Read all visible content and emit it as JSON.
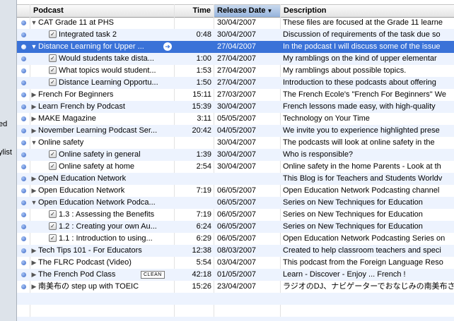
{
  "sidebar": {
    "fragments": [
      "ed",
      "ylist"
    ]
  },
  "columns": {
    "podcast": "Podcast",
    "time": "Time",
    "release_date": "Release Date",
    "description": "Description",
    "sort_indicator": "▼"
  },
  "clean_badge": "CLEAN",
  "rows": [
    {
      "kind": "parent",
      "open": true,
      "name": "CAT Grade 11 at PHS",
      "time": "",
      "date": "30/04/2007",
      "desc": "These files are focused at the Grade 11 learne"
    },
    {
      "kind": "child",
      "name": "Integrated task 2",
      "time": "0:48",
      "date": "30/04/2007",
      "desc": "Discussion of requirements of the task due so"
    },
    {
      "kind": "parent",
      "open": true,
      "selected": true,
      "name": "Distance Learning for Upper ...",
      "time": "",
      "date": "27/04/2007",
      "desc": "In the podcast I will discuss some of the issue"
    },
    {
      "kind": "child",
      "name": "Would students take dista...",
      "time": "1:00",
      "date": "27/04/2007",
      "desc": "My ramblings on the kind of upper elementar"
    },
    {
      "kind": "child",
      "name": "What topics would student...",
      "time": "1:53",
      "date": "27/04/2007",
      "desc": "My ramblings about possible topics."
    },
    {
      "kind": "child",
      "name": "Distance Learning Opportu...",
      "time": "1:50",
      "date": "27/04/2007",
      "desc": "Introduction to these podcasts about offering"
    },
    {
      "kind": "parent",
      "open": false,
      "name": "French For Beginners",
      "time": "15:11",
      "date": "27/03/2007",
      "desc": "The French Ecole's \"French For Beginners\" We"
    },
    {
      "kind": "parent",
      "open": false,
      "name": "Learn French by Podcast",
      "time": "15:39",
      "date": "30/04/2007",
      "desc": "French lessons made easy, with high-quality"
    },
    {
      "kind": "parent",
      "open": false,
      "name": "MAKE Magazine",
      "time": "3:11",
      "date": "05/05/2007",
      "desc": "Technology on Your Time"
    },
    {
      "kind": "parent",
      "open": false,
      "name": "November Learning Podcast Ser...",
      "time": "20:42",
      "date": "04/05/2007",
      "desc": "We invite you to experience highlighted prese"
    },
    {
      "kind": "parent",
      "open": true,
      "name": "Online safety",
      "time": "",
      "date": "30/04/2007",
      "desc": "The podcasts will look at online safety in the"
    },
    {
      "kind": "child",
      "name": "Online safety in general",
      "time": "1:39",
      "date": "30/04/2007",
      "desc": "Who is responsible?"
    },
    {
      "kind": "child",
      "name": "Online safety at home",
      "time": "2:54",
      "date": "30/04/2007",
      "desc": "Online safety in the home Parents - Look at th"
    },
    {
      "kind": "parent",
      "open": false,
      "name": "OpeN Education Network",
      "time": "",
      "date": "",
      "desc": "This Blog is for Teachers and Students Worldv"
    },
    {
      "kind": "parent",
      "open": false,
      "name": "Open Education Network",
      "time": "7:19",
      "date": "06/05/2007",
      "desc": "Open Education Network Podcasting channel"
    },
    {
      "kind": "parent",
      "open": true,
      "name": "Open Education Network Podca...",
      "time": "",
      "date": "06/05/2007",
      "desc": "Series on New Techniques for Education"
    },
    {
      "kind": "child",
      "name": "1.3 : Assessing the Benefits",
      "time": "7:19",
      "date": "06/05/2007",
      "desc": "Series on New Techniques for Education"
    },
    {
      "kind": "child",
      "name": "1.2 : Creating your own Au...",
      "time": "6:24",
      "date": "06/05/2007",
      "desc": "Series on New Techniques for Education"
    },
    {
      "kind": "child",
      "name": "1.1 : Introduction to using...",
      "time": "6:29",
      "date": "06/05/2007",
      "desc": "Open Education Network Podcasting Series on"
    },
    {
      "kind": "parent",
      "open": false,
      "name": "Tech Tips 101 - For Educators",
      "time": "12:38",
      "date": "08/03/2007",
      "desc": "Created to help classroom teachers and speci"
    },
    {
      "kind": "parent",
      "open": false,
      "name": "The FLRC Podcast (Video)",
      "time": "5:54",
      "date": "03/04/2007",
      "desc": "This podcast from the Foreign Language Reso"
    },
    {
      "kind": "parent",
      "open": false,
      "clean": true,
      "name": "The French Pod Class",
      "time": "42:18",
      "date": "01/05/2007",
      "desc": "Learn - Discover - Enjoy ... French !"
    },
    {
      "kind": "parent",
      "open": false,
      "name": "南美布の step up with TOEIC",
      "time": "15:26",
      "date": "23/04/2007",
      "desc": "ラジオのDJ、ナビゲーターでおなじみの南美布さ"
    }
  ],
  "empty_rows": 3
}
